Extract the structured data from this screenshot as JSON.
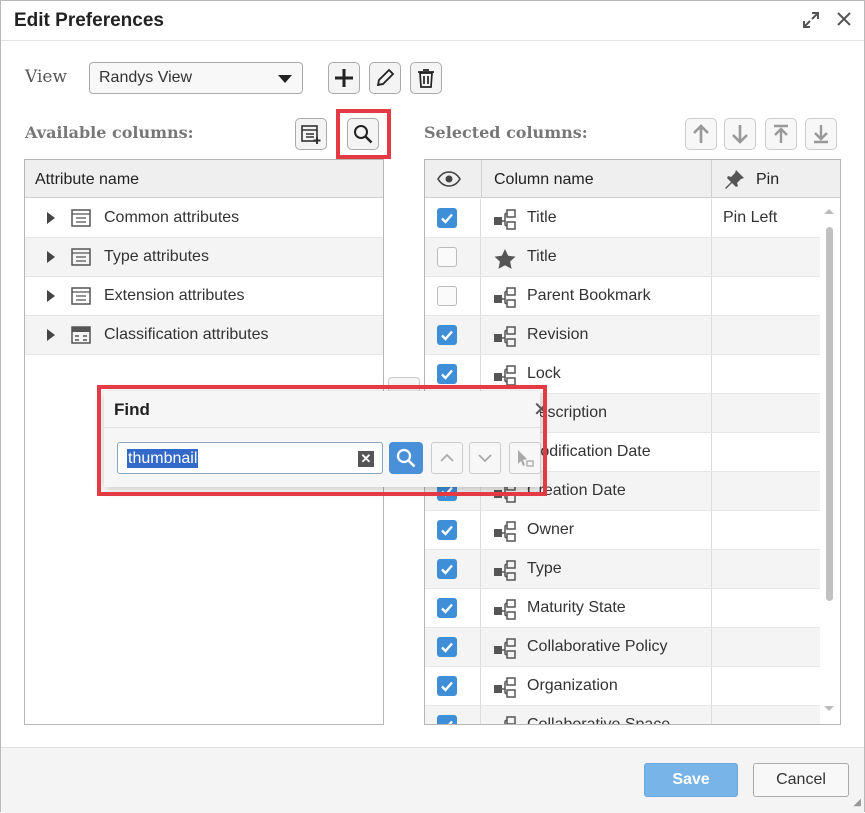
{
  "dialog": {
    "title": "Edit Preferences",
    "save_label": "Save",
    "cancel_label": "Cancel",
    "accent_color": "#3f8fd8"
  },
  "view": {
    "label": "View",
    "selected": "Randys View"
  },
  "available": {
    "label": "Available columns:",
    "header": "Attribute name",
    "items": [
      {
        "label": "Common attributes",
        "icon": "table-icon"
      },
      {
        "label": "Type attributes",
        "icon": "table-icon"
      },
      {
        "label": "Extension attributes",
        "icon": "table-icon"
      },
      {
        "label": "Classification attributes",
        "icon": "classification-icon"
      }
    ]
  },
  "selected": {
    "label": "Selected columns:",
    "header_column": "Column name",
    "header_pin": "Pin",
    "rows": [
      {
        "checked": true,
        "icon": "hierarchy-icon",
        "name": "Title",
        "pin": "Pin Left"
      },
      {
        "checked": false,
        "icon": "star-icon",
        "name": "Title",
        "pin": ""
      },
      {
        "checked": false,
        "icon": "hierarchy-icon",
        "name": "Parent Bookmark",
        "pin": ""
      },
      {
        "checked": true,
        "icon": "hierarchy-icon",
        "name": "Revision",
        "pin": ""
      },
      {
        "checked": true,
        "icon": "hierarchy-icon",
        "name": "Lock",
        "pin": ""
      },
      {
        "checked": true,
        "icon": "hierarchy-icon",
        "name": "Description",
        "pin": ""
      },
      {
        "checked": true,
        "icon": "hierarchy-icon",
        "name": "Modification Date",
        "pin": ""
      },
      {
        "checked": true,
        "icon": "hierarchy-icon",
        "name": "Creation Date",
        "pin": ""
      },
      {
        "checked": true,
        "icon": "hierarchy-icon",
        "name": "Owner",
        "pin": ""
      },
      {
        "checked": true,
        "icon": "hierarchy-icon",
        "name": "Type",
        "pin": ""
      },
      {
        "checked": true,
        "icon": "hierarchy-icon",
        "name": "Maturity State",
        "pin": ""
      },
      {
        "checked": true,
        "icon": "hierarchy-icon",
        "name": "Collaborative Policy",
        "pin": ""
      },
      {
        "checked": true,
        "icon": "hierarchy-icon",
        "name": "Organization",
        "pin": ""
      },
      {
        "checked": true,
        "icon": "hierarchy-icon",
        "name": "Collaborative Space",
        "pin": ""
      }
    ]
  },
  "find": {
    "title": "Find",
    "value": "thumbnail"
  }
}
